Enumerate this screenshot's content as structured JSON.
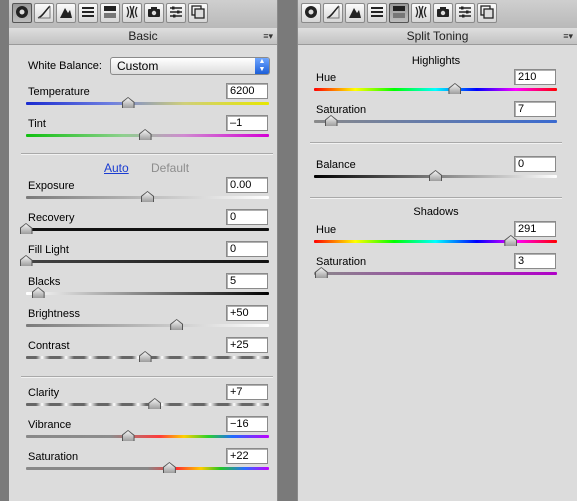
{
  "left_panel": {
    "title": "Basic",
    "menu_icon": "≡▾",
    "white_balance": {
      "label": "White Balance:",
      "value": "Custom"
    },
    "auto_label": "Auto",
    "default_label": "Default",
    "sliders": [
      {
        "label": "Temperature",
        "value": "6200",
        "level": 0.42
      },
      {
        "label": "Tint",
        "value": "–1",
        "level": 0.49
      },
      {
        "label": "Exposure",
        "value": "0.00",
        "level": 0.5
      },
      {
        "label": "Recovery",
        "value": "0",
        "level": 0.0
      },
      {
        "label": "Fill Light",
        "value": "0",
        "level": 0.0
      },
      {
        "label": "Blacks",
        "value": "5",
        "level": 0.05
      },
      {
        "label": "Brightness",
        "value": "+50",
        "level": 0.62
      },
      {
        "label": "Contrast",
        "value": "+25",
        "level": 0.49
      },
      {
        "label": "Clarity",
        "value": "+7",
        "level": 0.53
      },
      {
        "label": "Vibrance",
        "value": "−16",
        "level": 0.42
      },
      {
        "label": "Saturation",
        "value": "+22",
        "level": 0.59
      }
    ]
  },
  "right_panel": {
    "title": "Split Toning",
    "menu_icon": "≡▾",
    "highlights_heading": "Highlights",
    "shadows_heading": "Shadows",
    "sliders": [
      {
        "label": "Hue",
        "value": "210",
        "level": 0.58
      },
      {
        "label": "Saturation",
        "value": "7",
        "level": 0.07
      },
      {
        "label": "Balance",
        "value": "0",
        "level": 0.5
      },
      {
        "label": "Hue",
        "value": "291",
        "level": 0.81
      },
      {
        "label": "Saturation",
        "value": "3",
        "level": 0.03
      }
    ]
  },
  "toolbar_icons": [
    "camera-aperture-icon",
    "tone-curve-icon",
    "detail-icon",
    "hsl-grayscale-icon",
    "split-toning-icon",
    "lens-corrections-icon",
    "camera-calibration-icon",
    "presets-icon",
    "snapshots-icon"
  ]
}
